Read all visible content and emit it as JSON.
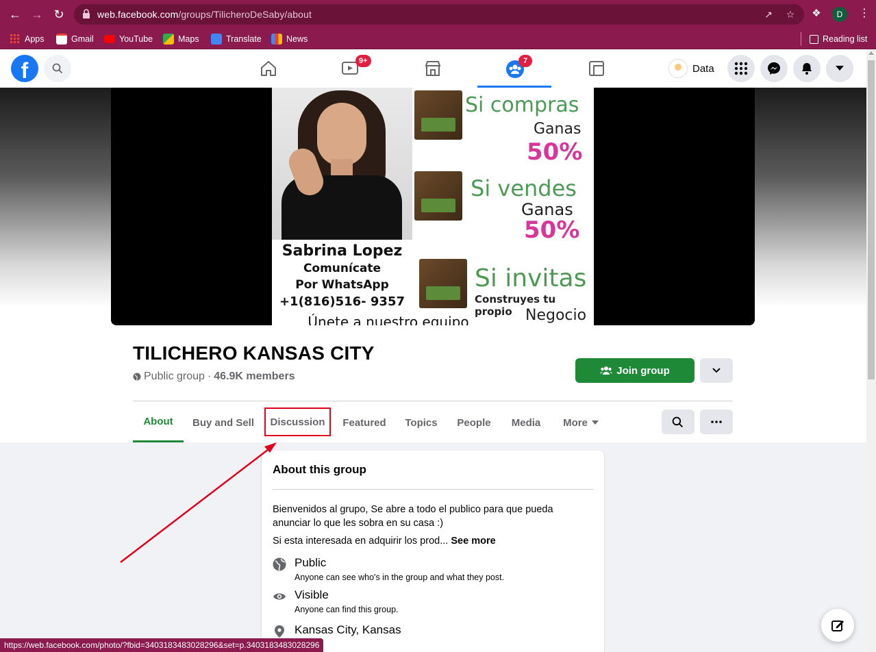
{
  "browser": {
    "url_host": "web.facebook.com",
    "url_path": "/groups/TilicheroDeSaby/about",
    "profile_initial": "D",
    "bookmarks": [
      {
        "label": "Apps"
      },
      {
        "label": "Gmail"
      },
      {
        "label": "YouTube"
      },
      {
        "label": "Maps"
      },
      {
        "label": "Translate"
      },
      {
        "label": "News"
      }
    ],
    "reading_list": "Reading list",
    "status_url": "https://web.facebook.com/photo/?fbid=3403183483028296&set=p.3403183483028296"
  },
  "fb_topbar": {
    "watch_badge": "9+",
    "groups_badge": "7",
    "profile_name": "Data"
  },
  "cover": {
    "name": "Sabrina Lopez",
    "line1": "Comunícate",
    "line2": "Por WhatsApp",
    "phone": "+1(816)516- 9357",
    "bottom_cut": "Únete a nuestro equipo",
    "promo1_a": "Si compras",
    "promo1_b": "Ganas",
    "promo1_c": "50%",
    "promo2_a": "Si vendes",
    "promo2_b": "Ganas",
    "promo2_c": "50%",
    "promo3_a": "Si invitas",
    "promo3_b": "Construyes tu propio",
    "promo3_c": "Negocio"
  },
  "group": {
    "title": "TILICHERO KANSAS CITY",
    "privacy": "Public group",
    "separator": "·",
    "members": "46.9K members",
    "join_label": "Join group"
  },
  "tabs": [
    {
      "label": "About"
    },
    {
      "label": "Buy and Sell"
    },
    {
      "label": "Discussion"
    },
    {
      "label": "Featured"
    },
    {
      "label": "Topics"
    },
    {
      "label": "People"
    },
    {
      "label": "Media"
    },
    {
      "label": "More"
    }
  ],
  "about": {
    "title": "About this group",
    "description": "Bienvenidos al grupo, Se abre a todo el publico para que pueda anunciar lo que les sobra en su casa :)",
    "snippet": "Si esta interesada en adquirir los prod...",
    "see_more": "See more",
    "public_title": "Public",
    "public_sub": "Anyone can see who's in the group and what they post.",
    "visible_title": "Visible",
    "visible_sub": "Anyone can find this group.",
    "location": "Kansas City, Kansas"
  },
  "colors": {
    "chrome": "#8b1a4e",
    "fb_blue": "#1877f2",
    "group_green": "#1e8a37",
    "annotation_red": "#e0001b"
  }
}
